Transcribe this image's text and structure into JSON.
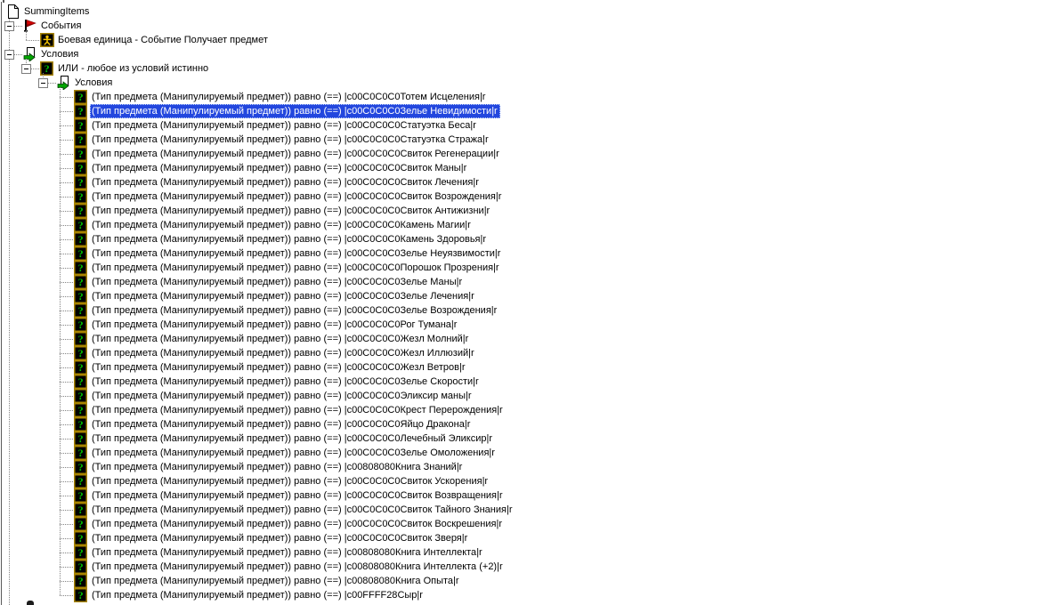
{
  "colors": {
    "selection_bg": "#2347DE",
    "selection_text": "#FFFFFF",
    "tree_text": "#000000",
    "tree_lines": "#848484",
    "condition_icon_green": "#00C400",
    "icon_border_gold": "#A88500",
    "event_flag_red": "#D40000"
  },
  "icons": {
    "root": "document-icon",
    "events": "flag-icon",
    "event_item": "unit-event-icon",
    "conditions": "conditions-arrow-icon",
    "or": "question-mark-icon",
    "condition_item": "question-mark-icon"
  },
  "tree": {
    "root": {
      "label": "SummingItems"
    },
    "events": {
      "label": "События",
      "items": [
        {
          "label": "Боевая единица - Событие Получает предмет"
        }
      ]
    },
    "conditions": {
      "label": "Условия",
      "or": {
        "label": "ИЛИ - любое из условий истинно",
        "group": {
          "label": "Условия",
          "row_prefix": "(Тип предмета (Манипулируемый предмет)) равно (==) ",
          "row_suffix": "|r",
          "selected_index": 1,
          "items": [
            {
              "code": "|c00C0C0C0",
              "name": "Тотем Исцеления"
            },
            {
              "code": "|c00C0C0C0",
              "name": "Зелье Невидимости"
            },
            {
              "code": "|c00C0C0C0",
              "name": "Статуэтка Беса"
            },
            {
              "code": "|c00C0C0C0",
              "name": "Статуэтка Стража"
            },
            {
              "code": "|c00C0C0C0",
              "name": "Свиток Регенерации"
            },
            {
              "code": "|c00C0C0C0",
              "name": "Свиток Маны"
            },
            {
              "code": "|c00C0C0C0",
              "name": "Свиток Лечения"
            },
            {
              "code": "|c00C0C0C0",
              "name": "Свиток Возрождения"
            },
            {
              "code": "|c00C0C0C0",
              "name": "Свиток Антижизни"
            },
            {
              "code": "|c00C0C0C0",
              "name": "Камень Магии"
            },
            {
              "code": "|c00C0C0C0",
              "name": "Камень Здоровья"
            },
            {
              "code": "|c00C0C0C0",
              "name": "Зелье Неуязвимости"
            },
            {
              "code": "|c00C0C0C0",
              "name": "Порошок Прозрения"
            },
            {
              "code": "|c00C0C0C0",
              "name": "Зелье Маны"
            },
            {
              "code": "|c00C0C0C0",
              "name": "Зелье Лечения"
            },
            {
              "code": "|c00C0C0C0",
              "name": "Зелье Возрождения"
            },
            {
              "code": "|c00C0C0C0",
              "name": "Рог Тумана"
            },
            {
              "code": "|c00C0C0C0",
              "name": "Жезл Молний"
            },
            {
              "code": "|c00C0C0C0",
              "name": "Жезл Иллюзий"
            },
            {
              "code": "|c00C0C0C0",
              "name": "Жезл Ветров"
            },
            {
              "code": "|c00C0C0C0",
              "name": "Зелье Скорости"
            },
            {
              "code": "|c00C0C0C0",
              "name": "Эликсир маны"
            },
            {
              "code": "|c00C0C0C0",
              "name": "Крест Перерождения"
            },
            {
              "code": "|c00C0C0C0",
              "name": "Яйцо Дракона"
            },
            {
              "code": "|c00C0C0C0",
              "name": "Лечебный Эликсир"
            },
            {
              "code": "|c00C0C0C0",
              "name": "Зелье Омоложения"
            },
            {
              "code": "|c00808080",
              "name": "Книга Знаний"
            },
            {
              "code": "|c00C0C0C0",
              "name": "Свиток Ускорения"
            },
            {
              "code": "|c00C0C0C0",
              "name": "Свиток Возвращения"
            },
            {
              "code": "|c00C0C0C0",
              "name": "Свиток Тайного Знания"
            },
            {
              "code": "|c00C0C0C0",
              "name": "Свиток Воскрешения"
            },
            {
              "code": "|c00C0C0C0",
              "name": "Свиток Зверя"
            },
            {
              "code": "|c00808080",
              "name": "Книга Интеллекта"
            },
            {
              "code": "|c00808080",
              "name": "Книга Интеллекта (+2)"
            },
            {
              "code": "|c00808080",
              "name": "Книга Опыта"
            },
            {
              "code": "|c00FFFF28",
              "name": "Сыр"
            }
          ]
        }
      }
    }
  }
}
